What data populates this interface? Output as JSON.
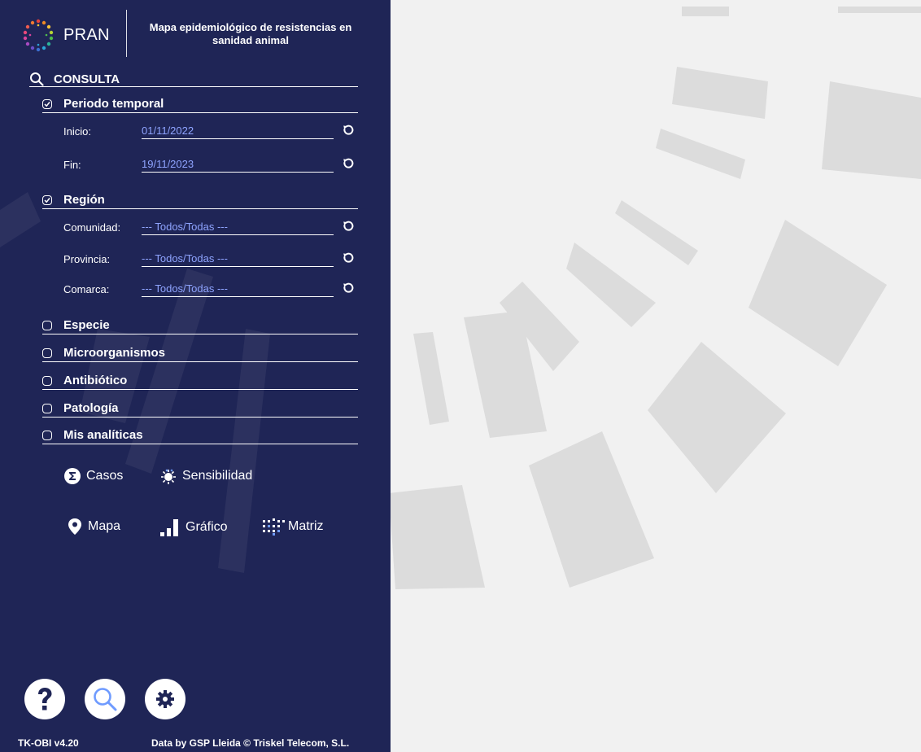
{
  "header": {
    "brand": "PRAN",
    "title": "Mapa epidemiológico de resistencias en sanidad animal"
  },
  "consulta": {
    "label": "CONSULTA"
  },
  "periodo": {
    "label": "Periodo temporal",
    "checked": true,
    "inicio_label": "Inicio:",
    "inicio_value": "01/11/2022",
    "fin_label": "Fin:",
    "fin_value": "19/11/2023"
  },
  "region": {
    "label": "Región",
    "checked": true,
    "comunidad_label": "Comunidad:",
    "comunidad_value": "--- Todos/Todas ---",
    "provincia_label": "Provincia:",
    "provincia_value": "--- Todos/Todas ---",
    "comarca_label": "Comarca:",
    "comarca_value": "--- Todos/Todas ---"
  },
  "filters": [
    {
      "label": "Especie",
      "checked": false
    },
    {
      "label": "Microorganismos",
      "checked": false
    },
    {
      "label": "Antibiótico",
      "checked": false
    },
    {
      "label": "Patología",
      "checked": false
    },
    {
      "label": "Mis analíticas",
      "checked": false
    }
  ],
  "actions": {
    "casos": "Casos",
    "sensibilidad": "Sensibilidad",
    "mapa": "Mapa",
    "grafico": "Gráfico",
    "matriz": "Matriz"
  },
  "footer": {
    "version": "TK-OBI v4.20",
    "credits": "Data by GSP Lleida © Triskel Telecom, S.L."
  },
  "colors": {
    "sidebar_bg": "#1f2556",
    "field_value": "#8fa4ff",
    "search_accent": "#6f9bff",
    "map_bg": "#f1f1f1"
  },
  "icons": {
    "help": "question-mark-icon",
    "search": "magnifier-icon",
    "settings": "gear-icon"
  }
}
